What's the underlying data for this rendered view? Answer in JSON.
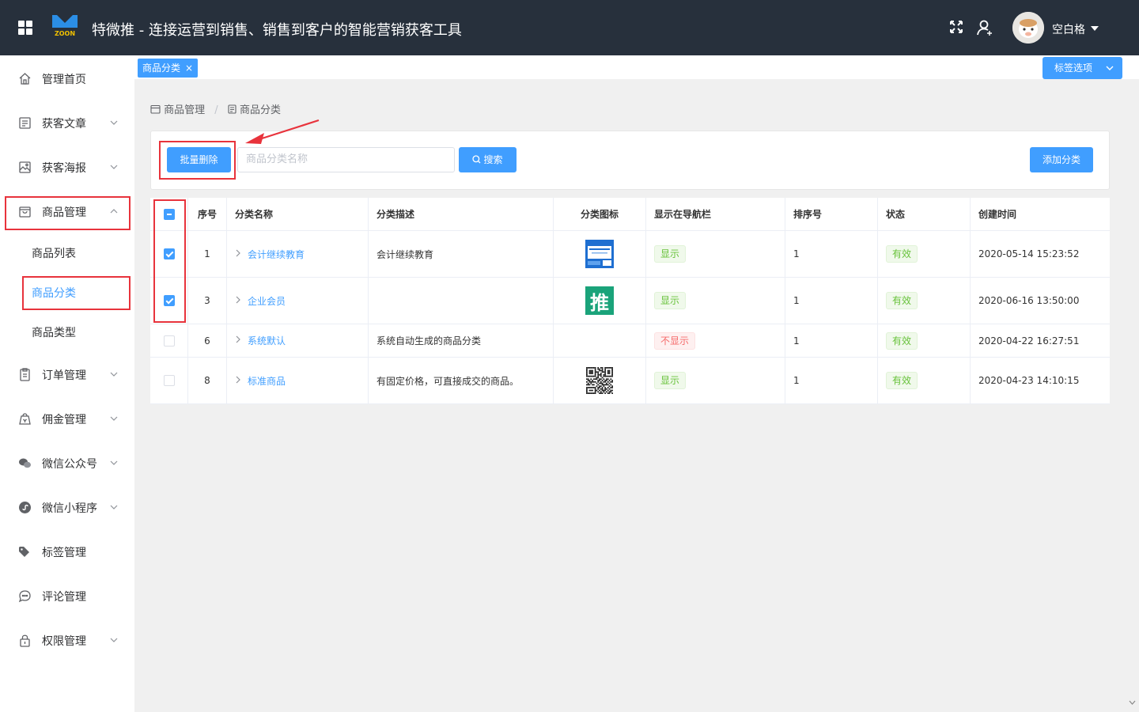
{
  "header": {
    "app_title": "特微推 - 连接运营到销售、销售到客户的智能营销获客工具",
    "logo_text": "ZOON",
    "user_name": "空白格"
  },
  "sidebar": {
    "items": [
      {
        "label": "管理首页",
        "icon": "home-icon"
      },
      {
        "label": "获客文章",
        "icon": "article-icon"
      },
      {
        "label": "获客海报",
        "icon": "poster-icon"
      },
      {
        "label": "商品管理",
        "icon": "goods-icon"
      },
      {
        "label": "订单管理",
        "icon": "order-icon"
      },
      {
        "label": "佣金管理",
        "icon": "commission-icon"
      },
      {
        "label": "微信公众号",
        "icon": "wechat-official-icon"
      },
      {
        "label": "微信小程序",
        "icon": "mini-program-icon"
      },
      {
        "label": "标签管理",
        "icon": "tag-icon"
      },
      {
        "label": "评论管理",
        "icon": "comment-icon"
      },
      {
        "label": "权限管理",
        "icon": "lock-icon"
      }
    ],
    "sub_items": [
      "商品列表",
      "商品分类",
      "商品类型"
    ]
  },
  "tabs": {
    "active_tab": "商品分类",
    "close": "×",
    "options_label": "标签选项"
  },
  "breadcrumb": {
    "parent": "商品管理",
    "sep": "/",
    "current": "商品分类"
  },
  "toolbar": {
    "batch_delete": "批量删除",
    "search_placeholder": "商品分类名称",
    "search_label": "搜索",
    "add_label": "添加分类"
  },
  "table": {
    "columns": [
      "序号",
      "分类名称",
      "分类描述",
      "分类图标",
      "显示在导航栏",
      "排序号",
      "状态",
      "创建时间"
    ],
    "rows": [
      {
        "checked": true,
        "no": "1",
        "name": "会计继续教育",
        "desc": "会计继续教育",
        "icon": "image",
        "nav": "显示",
        "sort": "1",
        "status": "有效",
        "created": "2020-05-14 15:23:52"
      },
      {
        "checked": true,
        "no": "3",
        "name": "企业会员",
        "desc": "",
        "icon": "tui",
        "icon_text": "推",
        "nav": "显示",
        "sort": "1",
        "status": "有效",
        "created": "2020-06-16 13:50:00"
      },
      {
        "checked": false,
        "no": "6",
        "name": "系统默认",
        "desc": "系统自动生成的商品分类",
        "icon": "none",
        "nav": "不显示",
        "sort": "1",
        "status": "有效",
        "created": "2020-04-22 16:27:51"
      },
      {
        "checked": false,
        "no": "8",
        "name": "标准商品",
        "desc": "有固定价格，可直接成交的商品。",
        "icon": "qr",
        "nav": "显示",
        "sort": "1",
        "status": "有效",
        "created": "2020-04-23 14:10:15"
      }
    ]
  },
  "colors": {
    "primary": "#409eff",
    "header_bg": "#27303c",
    "highlight": "#e8333c",
    "success": "#67c23a",
    "danger": "#f56c6c"
  }
}
